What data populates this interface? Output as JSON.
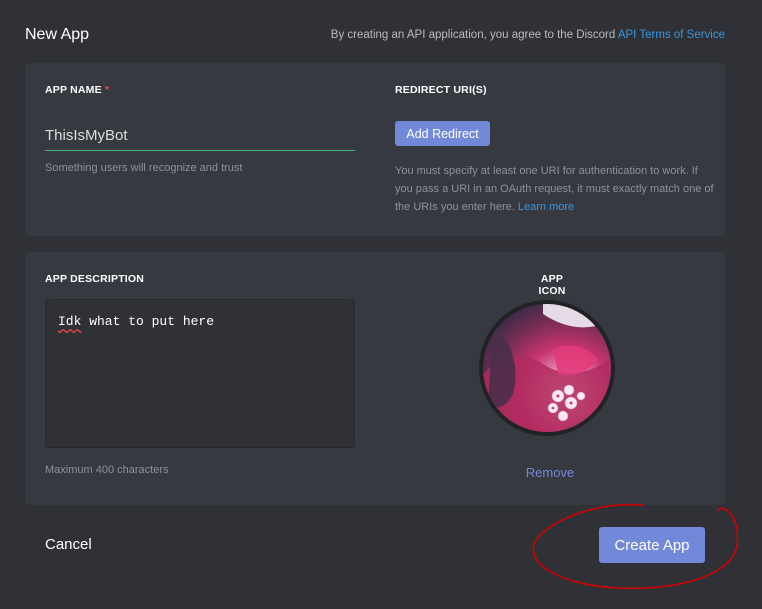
{
  "header": {
    "title": "New App",
    "terms_prefix": "By creating an API application, you agree to the Discord ",
    "terms_link": "API Terms of Service"
  },
  "app_name": {
    "label": "App Name",
    "required_marker": "*",
    "value": "ThisIsMyBot",
    "hint": "Something users will recognize and trust"
  },
  "redirect": {
    "label": "Redirect URI(s)",
    "button_label": "Add Redirect",
    "note": "You must specify at least one URI for authentication to work. If you pass a URI in an OAuth request, it must exactly match one of the URIs you enter here. ",
    "learn_more": "Learn more"
  },
  "description": {
    "label": "App Description",
    "misspelled_word": "Idk",
    "value_rest": " what to put here",
    "hint": "Maximum 400 characters"
  },
  "app_icon": {
    "label": "App Icon",
    "icon": "app-avatar-image",
    "remove_label": "Remove"
  },
  "footer": {
    "cancel_label": "Cancel",
    "create_label": "Create App"
  },
  "colors": {
    "background": "#2f3136",
    "card": "#36393f",
    "blurple": "#7289da",
    "link": "#3a96e0",
    "input_focus": "#43b581",
    "annotation": "#d10000"
  }
}
